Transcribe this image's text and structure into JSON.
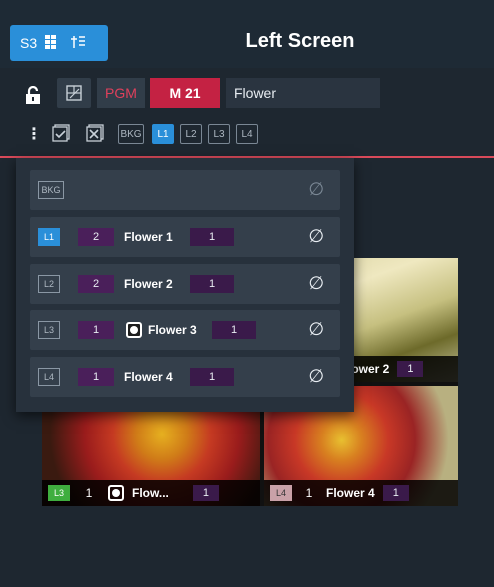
{
  "header": {
    "screen_button": "S3",
    "title": "Left Screen"
  },
  "toolbar": {
    "pgm_label": "PGM",
    "memory_label": "M 21",
    "content_name": "Flower",
    "layer_chips": [
      "BKG",
      "L1",
      "L2",
      "L3",
      "L4"
    ],
    "active_layer": "L1"
  },
  "dropdown": {
    "rows": [
      {
        "layer": "BKG",
        "num_a": "",
        "name": "",
        "num_b": "",
        "active": false
      },
      {
        "layer": "L1",
        "num_a": "2",
        "name": "Flower 1",
        "num_b": "1",
        "active": true
      },
      {
        "layer": "L2",
        "num_a": "2",
        "name": "Flower 2",
        "num_b": "1",
        "active": false
      },
      {
        "layer": "L3",
        "num_a": "1",
        "name": "Flower 3",
        "num_b": "1",
        "active": false
      },
      {
        "layer": "L4",
        "num_a": "1",
        "name": "Flower 4",
        "num_b": "1",
        "active": false
      }
    ],
    "empty_symbol": "∅"
  },
  "preview": {
    "tr_caption": {
      "name": "lower 2",
      "count": "1"
    },
    "bl_caption": {
      "layer": "L3",
      "num": "1",
      "name": "Flow...",
      "count": "1"
    },
    "br_caption": {
      "layer": "L4",
      "num": "1",
      "name": "Flower 4",
      "count": "1"
    }
  },
  "colors": {
    "accent": "#2a8fd9",
    "program_red": "#c42243",
    "live_line": "#d94a5a",
    "l3_badge": "#3fae3f",
    "l4_badge": "#c9a1a8"
  }
}
